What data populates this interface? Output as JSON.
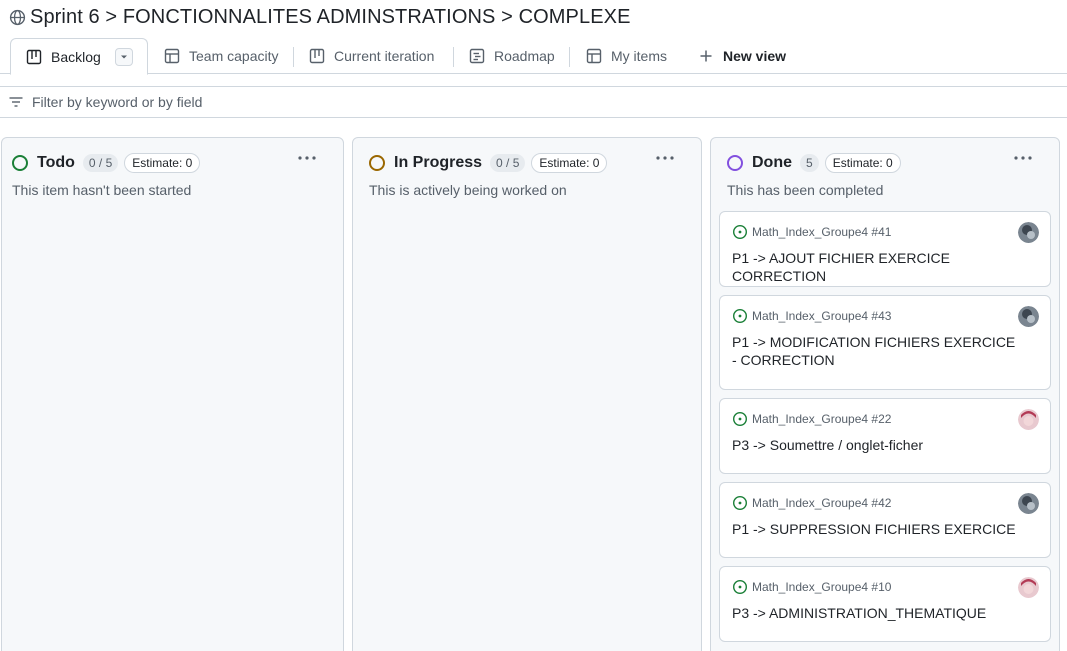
{
  "header": {
    "title": "Sprint 6 > FONCTIONNALITES ADMINSTRATIONS > COMPLEXE",
    "icon": "globe-icon"
  },
  "tabs": [
    {
      "label": "Backlog",
      "icon": "board-icon",
      "active": true
    },
    {
      "label": "Team capacity",
      "icon": "table-icon"
    },
    {
      "label": "Current iteration",
      "icon": "board-icon"
    },
    {
      "label": "Roadmap",
      "icon": "roadmap-icon"
    },
    {
      "label": "My items",
      "icon": "table-icon"
    },
    {
      "label": "New view",
      "icon": "plus-icon"
    }
  ],
  "filter": {
    "placeholder": "Filter by keyword or by field",
    "value": ""
  },
  "columns": [
    {
      "name": "Todo",
      "count": "0 / 5",
      "estimate": "Estimate: 0",
      "description": "This item hasn't been started",
      "status_color": "#1a7f37",
      "cards": []
    },
    {
      "name": "In Progress",
      "count": "0 / 5",
      "estimate": "Estimate: 0",
      "description": "This is actively being worked on",
      "status_color": "#9a6700",
      "cards": []
    },
    {
      "name": "Done",
      "count": "5",
      "estimate": "Estimate: 0",
      "description": "This has been completed",
      "status_color": "#8250df",
      "cards": [
        {
          "repo": "Math_Index_Groupe4 #41",
          "title": "P1 -> AJOUT FICHIER EXERCICE CORRECTION",
          "avatar": "avatar-gray"
        },
        {
          "repo": "Math_Index_Groupe4 #43",
          "title": "P1 -> MODIFICATION FICHIERS EXERCICE - CORRECTION",
          "avatar": "avatar-gray"
        },
        {
          "repo": "Math_Index_Groupe4 #22",
          "title": "P3 -> Soumettre / onglet-ficher",
          "avatar": "avatar-pink"
        },
        {
          "repo": "Math_Index_Groupe4 #42",
          "title": "P1 -> SUPPRESSION FICHIERS EXERCICE",
          "avatar": "avatar-gray"
        },
        {
          "repo": "Math_Index_Groupe4 #10",
          "title": "P3 -> ADMINISTRATION_THEMATIQUE",
          "avatar": "avatar-pink"
        }
      ]
    }
  ],
  "colors": {
    "border": "#d0d7de",
    "column_bg": "#f6f8fa",
    "open_issue": "#1a7f37",
    "muted_text": "#57606a"
  }
}
